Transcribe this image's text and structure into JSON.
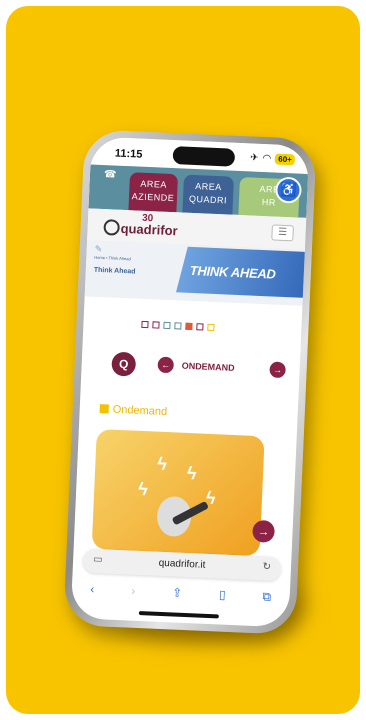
{
  "status_bar": {
    "time": "11:15",
    "battery": "60+"
  },
  "top_nav": {
    "tabs": [
      {
        "line1": "AREA",
        "line2": "AZIENDE"
      },
      {
        "line1": "AREA",
        "line2": "QUADRI"
      },
      {
        "line1": "ARE",
        "line2": "HR"
      }
    ]
  },
  "header": {
    "logo_text": "quadrifor",
    "logo_badge": "30"
  },
  "banner": {
    "title": "THINK AHEAD",
    "breadcrumb": "Home  •  Think Ahead",
    "page_label": "Think Ahead"
  },
  "category_nav": {
    "current": "ONDEMAND"
  },
  "section": {
    "title": "Ondemand"
  },
  "browser": {
    "url": "quadrifor.it"
  },
  "colors": {
    "card_bg": "#f8c400",
    "brand_maroon": "#8b2346",
    "brand_blue": "#3e6296",
    "nav_bg": "#5b8fa0",
    "section_yellow": "#f2b600",
    "square_colors": [
      "#8b2346",
      "#8b2346",
      "#5b8fa0",
      "#5b8fa0",
      "#e05a3a",
      "#8b2346",
      "#f2c200"
    ]
  }
}
